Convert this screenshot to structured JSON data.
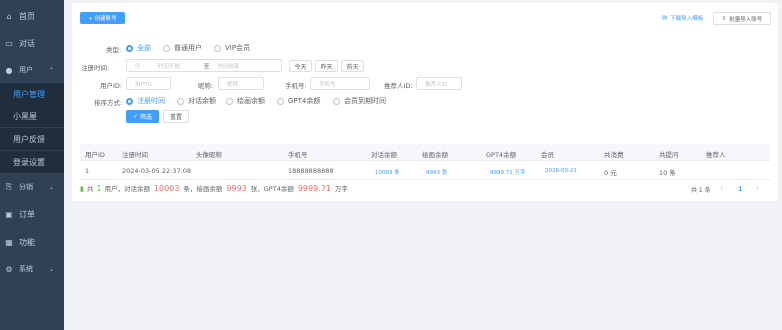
{
  "sidebar": {
    "home": "首页",
    "dialog": "对话",
    "user": "用户",
    "user_manage": "用户管理",
    "blacklist": "小黑屋",
    "feedback": "用户反馈",
    "login_settings": "登录设置",
    "distribution": "分销",
    "order": "订单",
    "feature": "功能",
    "system": "系统"
  },
  "toolbar": {
    "create": "+ 创建账号",
    "download_template": "下载导入模板",
    "batch_import": "批量导入账号"
  },
  "filters": {
    "type_label": "类型:",
    "type_options": [
      "全部",
      "普通用户",
      "VIP会员"
    ],
    "reg_time_label": "注册时间:",
    "start_placeholder": "时间开始",
    "range_sep": "至",
    "end_placeholder": "时间结束",
    "quick": [
      "今天",
      "昨天",
      "前天"
    ],
    "uid_label": "用户ID:",
    "uid_placeholder": "用户ID",
    "nickname_label": "昵称:",
    "nickname_placeholder": "昵称",
    "phone_label": "手机号:",
    "phone_placeholder": "手机号",
    "referrer_label": "推荐人ID:",
    "referrer_placeholder": "推荐人ID",
    "sort_label": "排序方式:",
    "sort_options": [
      "注册时间",
      "对话余额",
      "绘画余额",
      "GPT4余额",
      "会员到期时间"
    ],
    "search": "筛选",
    "reset": "重置"
  },
  "table": {
    "headers": [
      "用户ID",
      "注册时间",
      "头像昵称",
      "手机号",
      "对话余额",
      "绘画余额",
      "GPT4余额",
      "会员",
      "共消费",
      "共提问",
      "推荐人"
    ],
    "rows": [
      {
        "id": "1",
        "reg_time": "2024-03-05 22:37:08",
        "nickname": "",
        "phone": "18888888888",
        "dialog": "10003 条",
        "draw": "9993 张",
        "gpt4": "9999.71 万字",
        "vip": "2026-03-21",
        "spent": "0 元",
        "asked": "10 条",
        "referrer": ""
      }
    ]
  },
  "summary": {
    "p1": "共",
    "users": "1",
    "p2": "用户，对话余额",
    "dialog": "10003",
    "p3": "条，绘画余额",
    "draw": "9993",
    "p4": "张，GPT4余额",
    "gpt4": "9999.71",
    "p5": "万字"
  },
  "pagination": {
    "total": "共 1 条",
    "prev": "‹",
    "page": "1",
    "next": "›"
  }
}
